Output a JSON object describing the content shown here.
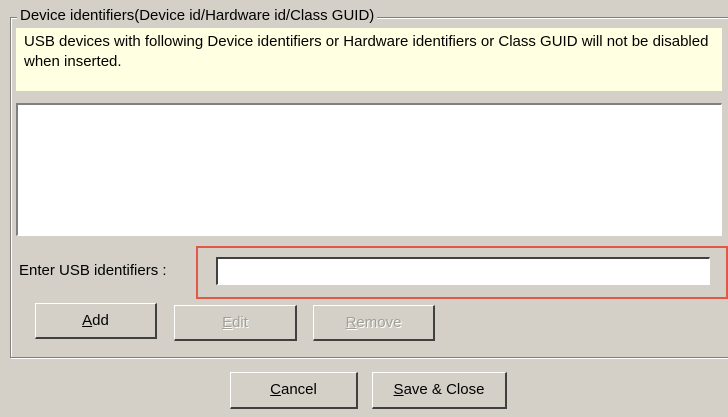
{
  "groupbox": {
    "legend": "Device identifiers(Device id/Hardware id/Class GUID)",
    "note": "USB devices with following Device identifiers or Hardware identifiers or Class GUID will not be disabled when inserted."
  },
  "identifiers_list": {
    "items": []
  },
  "identifier_field": {
    "label": "Enter USB identifiers :",
    "value": "",
    "highlight_color": "#e05848"
  },
  "buttons": {
    "add": {
      "mnemonic": "A",
      "rest": "dd",
      "enabled": true
    },
    "edit": {
      "mnemonic": "E",
      "rest": "dit",
      "enabled": false
    },
    "remove": {
      "mnemonic": "R",
      "rest": "emove",
      "enabled": false
    }
  },
  "footer": {
    "cancel": {
      "mnemonic": "C",
      "rest": "ancel"
    },
    "save_close": {
      "mnemonic": "S",
      "rest": "ave & Close"
    }
  },
  "colors": {
    "dialog_background": "#d4d0c8",
    "note_background": "#ffffe1",
    "disabled_text": "#a3a096"
  }
}
